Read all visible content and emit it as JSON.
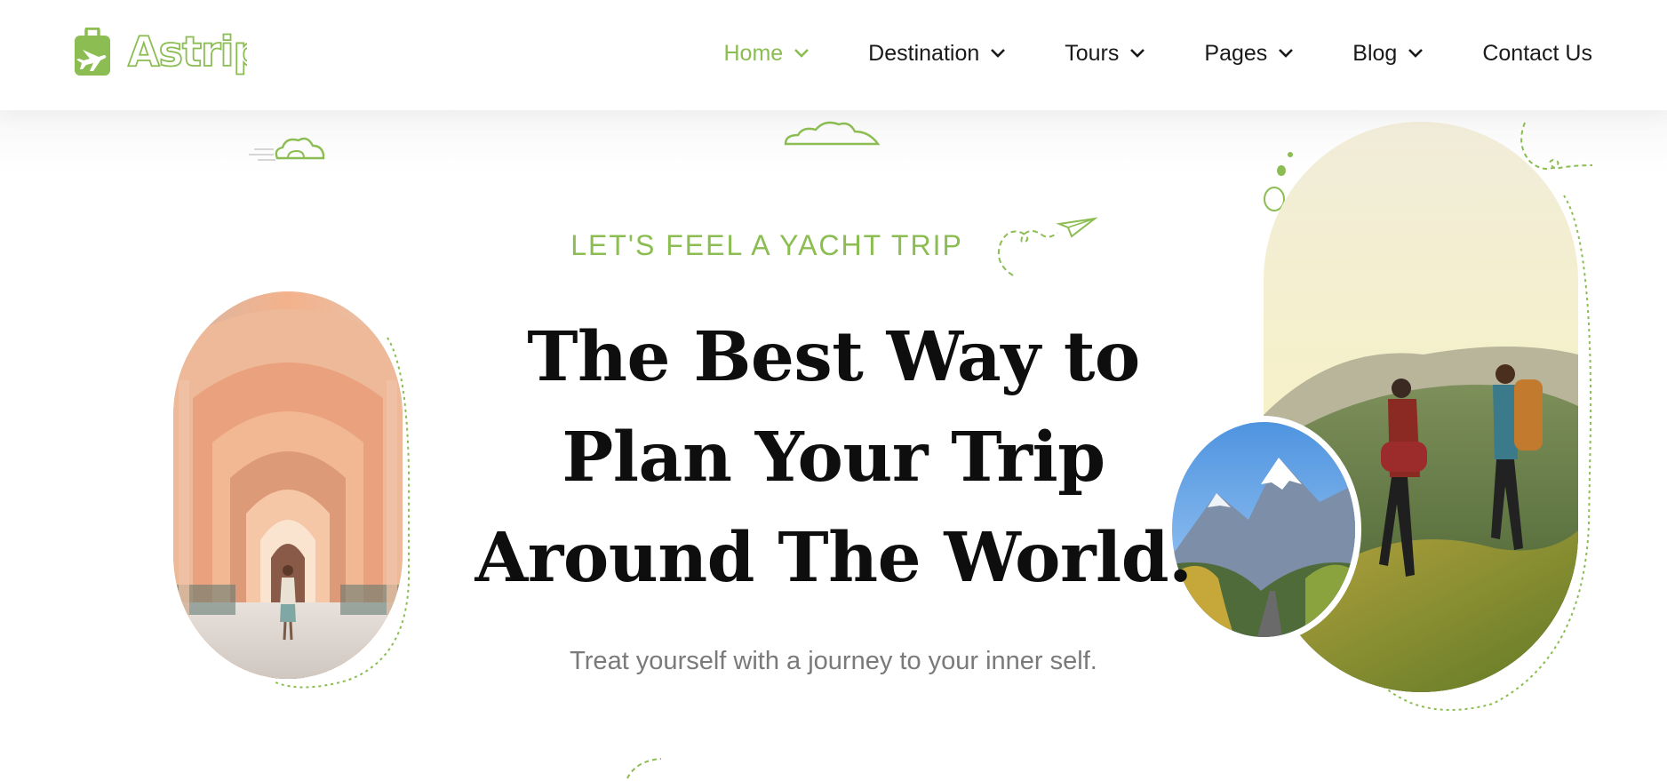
{
  "brand": {
    "name": "Astrip",
    "logo_icon": "suitcase-plane-icon"
  },
  "nav": {
    "items": [
      {
        "label": "Home",
        "has_dropdown": true,
        "active": true
      },
      {
        "label": "Destination",
        "has_dropdown": true,
        "active": false
      },
      {
        "label": "Tours",
        "has_dropdown": true,
        "active": false
      },
      {
        "label": "Pages",
        "has_dropdown": true,
        "active": false
      },
      {
        "label": "Blog",
        "has_dropdown": true,
        "active": false
      },
      {
        "label": "Contact Us",
        "has_dropdown": false,
        "active": false
      }
    ]
  },
  "hero": {
    "subtitle": "LET'S FEEL A YACHT TRIP",
    "headline_lines": [
      "The Best Way to",
      "Plan Your Trip",
      "Around The World."
    ],
    "tagline": "Treat yourself with a journey to your inner self."
  },
  "images": {
    "left": "arched-corridor-photo",
    "right": "hikers-on-hill-photo",
    "circle": "snowy-mountain-road-photo"
  },
  "colors": {
    "accent": "#8bbd52",
    "heading": "#0e0e0e",
    "nav_text": "#1a1a1a",
    "tagline": "#7a7a7a"
  }
}
